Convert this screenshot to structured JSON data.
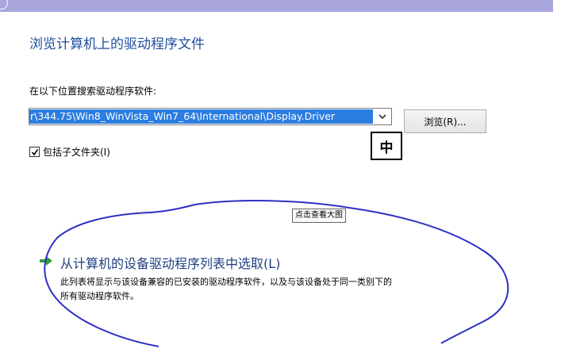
{
  "dialog": {
    "title": "浏览计算机上的驱动程序文件",
    "location_label": "在以下位置搜索驱动程序软件:",
    "path_value": "r\\344.75\\Win8_WinVista_Win7_64\\International\\Display.Driver",
    "browse_label": "浏览(R)...",
    "include_subfolders_label": "包括子文件夹(I)",
    "include_subfolders_checked": true,
    "ime_indicator": "中",
    "enlarge_tip": "点击查看大图",
    "pick_option": {
      "title": "从计算机的设备驱动程序列表中选取(L)",
      "desc_line1": "此列表将显示与该设备兼容的已安装的驱动程序软件，以及与该设备处于同一类别下的",
      "desc_line2": "所有驱动程序软件。"
    }
  },
  "colors": {
    "titlebar": "#a8a6dd",
    "heading_blue": "#1f4e9b",
    "selection": "#2c7de0",
    "annotation_ink": "#2d2fc4",
    "arrow_green": "#2e9b3a"
  }
}
